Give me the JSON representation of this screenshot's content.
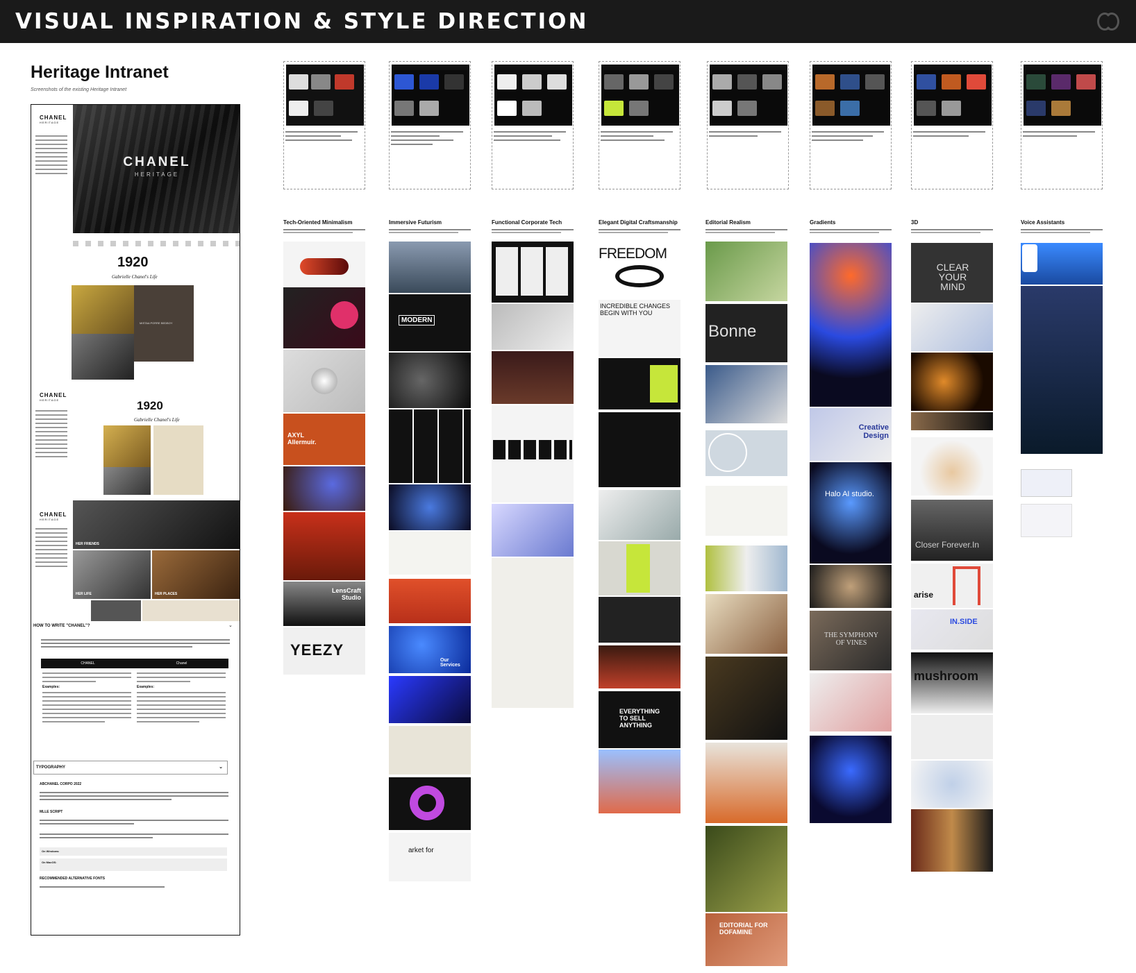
{
  "header": {
    "title": "VISUAL INSPIRATION & STYLE DIRECTION",
    "logo_icon": "chanel-cc-icon"
  },
  "heritage": {
    "title": "Heritage Intranet",
    "subtitle": "Screenshots of the existing Heritage Intranet",
    "brand": "CHANEL",
    "brand_sub": "HERITAGE",
    "hero_word": "CHANEL",
    "hero_sub": "HERITAGE",
    "year": "1920",
    "subtitle_script": "Gabrielle Chanel's Life",
    "photo_caption": "MISTAA PORRE BEDBOY",
    "her_friends": "HER FRIENDS",
    "her_life": "HER LIFE",
    "her_places": "HER PLACES",
    "howto_header": "HOW TO WRITE \"CHANEL\"?",
    "col_a": "CHANEL",
    "col_b": "Chanel",
    "examples": "Examples:",
    "typography_header": "TYPOGRAPHY",
    "corpo": "ABCHANEL CORPO 2022",
    "mlle": "MLLE SCRIPT",
    "windows_label": "On Windows:",
    "macos_label": "On MacOS:",
    "alt_fonts": "RECOMMENDED ALTERNATIVE FONTS"
  },
  "categories": [
    {
      "name": "Tech-Oriented Minimalism"
    },
    {
      "name": "Immersive Futurism"
    },
    {
      "name": "Functional Corporate Tech"
    },
    {
      "name": "Elegant Digital Craftsmanship"
    },
    {
      "name": "Editorial Realism"
    },
    {
      "name": "Gradients"
    },
    {
      "name": "3D"
    },
    {
      "name": "Voice Assistants"
    }
  ],
  "tile_text": {
    "axyl": "AXYL Allermuir.",
    "lenscraft": "LensCraft Studio",
    "yeezy": "YEEZY",
    "modern": "MODERN",
    "our_services": "Our Services",
    "market": "arket for",
    "freedom": "FREEDOM",
    "incredible": "INCREDIBLE CHANGES BEGIN WITH YOU",
    "everything": "EVERYTHING TO SELL ANYTHING",
    "bonne": "Bonne",
    "editorial_dop": "EDITORIAL FOR DOFAMINE",
    "creative": "Creative Design",
    "halo": "Halo AI studio.",
    "symphony": "THE SYMPHONY OF VINES",
    "clear": "CLEAR YOUR MIND",
    "closer": "Closer Forever.In",
    "arise": "arise",
    "inside": "IN.SIDE",
    "mushroom": "mushroom"
  }
}
